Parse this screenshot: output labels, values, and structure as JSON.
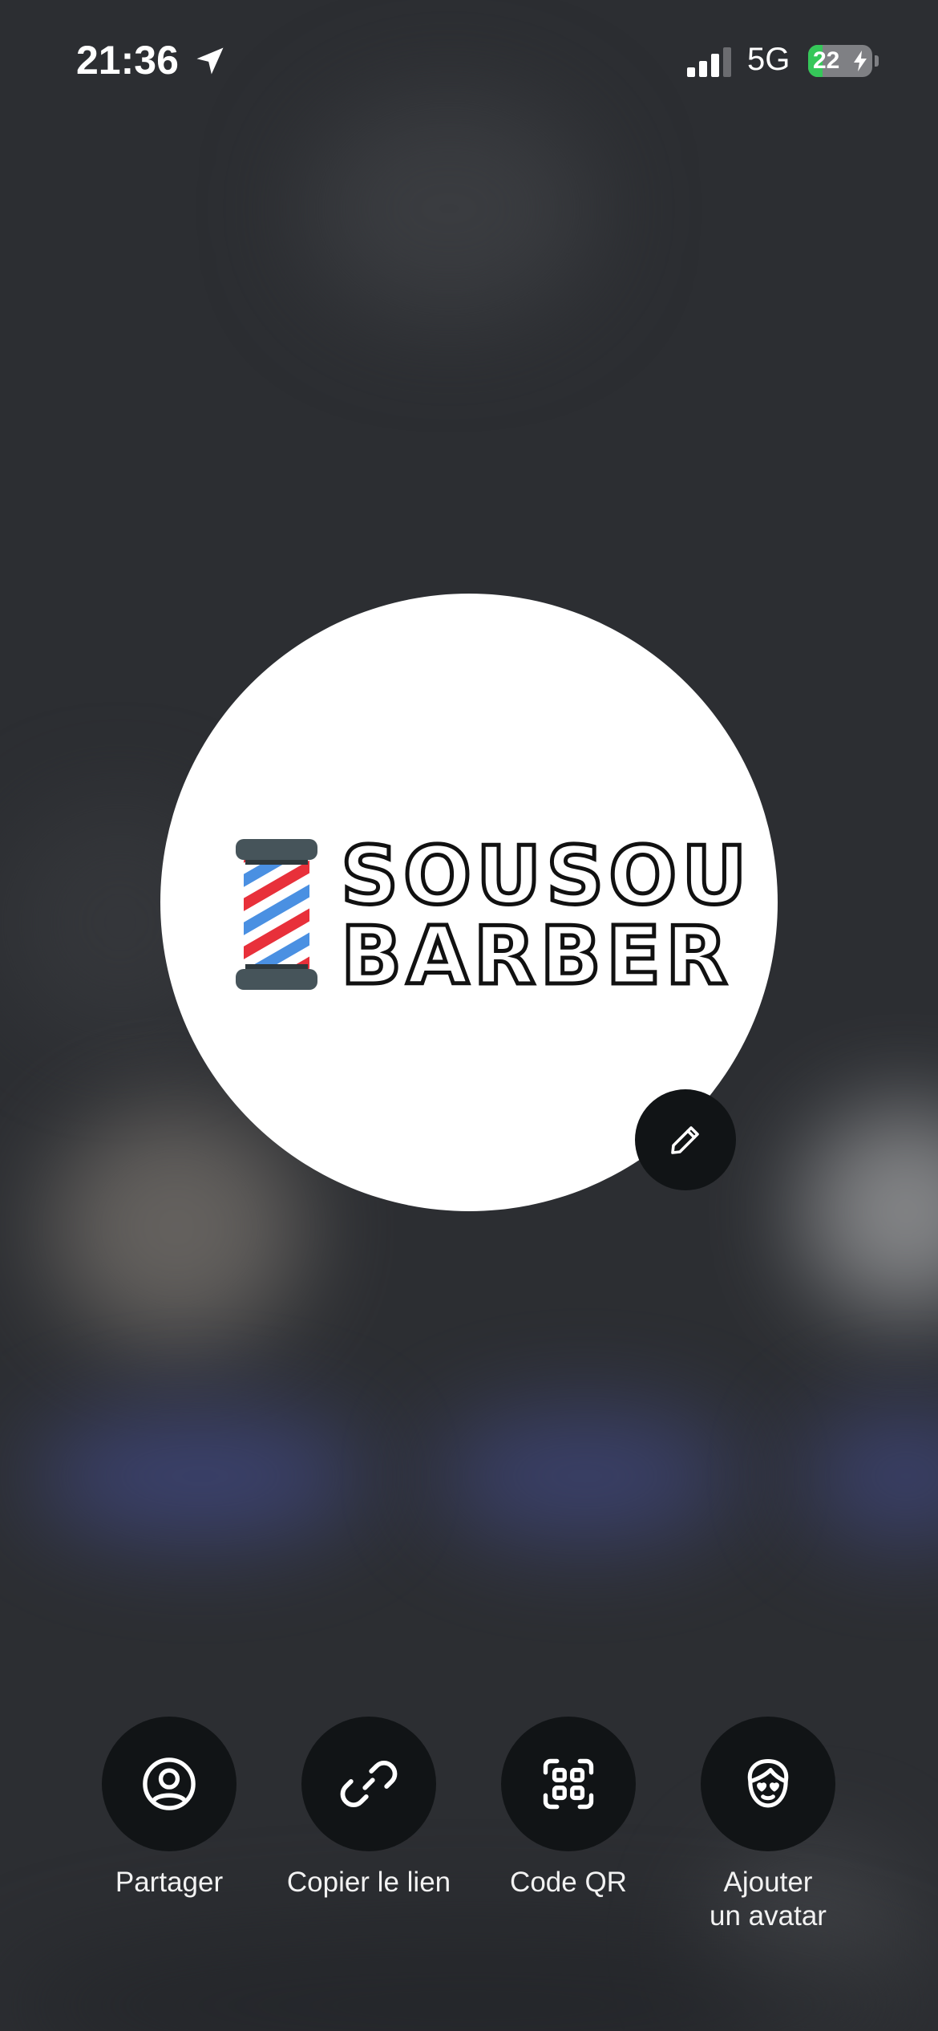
{
  "status_bar": {
    "time": "21:36",
    "network": "5G",
    "battery_level": "22",
    "battery_fill": 0.22,
    "location_icon": "location-arrow-icon",
    "signal_icon": "signal-bars-icon",
    "charging_icon": "bolt-icon"
  },
  "profile": {
    "logo_text_line1": "SOUSOU",
    "logo_text_line2": "BARBER",
    "logo_icon": "barber-pole-icon",
    "edit_icon": "pencil-icon"
  },
  "actions": [
    {
      "label": "Partager",
      "icon": "user-circle-icon"
    },
    {
      "label": "Copier le lien",
      "icon": "link-icon"
    },
    {
      "label": "Code QR",
      "icon": "qr-code-icon"
    },
    {
      "label": "Ajouter\nun avatar",
      "icon": "avatar-face-icon"
    }
  ],
  "colors": {
    "background": "#2c2e32",
    "button_background": "#111416",
    "battery_green": "#35c759"
  }
}
